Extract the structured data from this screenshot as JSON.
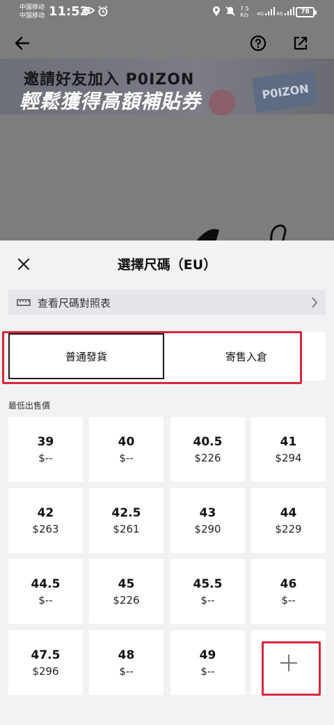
{
  "status_bar": {
    "carrier_1": "中国移动",
    "carrier_2": "中国移动",
    "time": "11:52",
    "net_speed_value": "7.5",
    "net_speed_unit": "K/s",
    "signal_1": "4G",
    "signal_2": "4G",
    "battery": "78"
  },
  "banner": {
    "line1": "邀請好友加入 P0IZON",
    "line2": "輕鬆獲得高額補貼券",
    "logo": "P0IZON"
  },
  "sheet": {
    "title": "選擇尺碼（EU）",
    "size_chart_label": "查看尺碼對照表",
    "shipping_tabs": [
      {
        "label": "普通發貨",
        "selected": true
      },
      {
        "label": "寄售入倉",
        "selected": false
      }
    ],
    "section_label": "最低出售價",
    "sizes": [
      {
        "size": "39",
        "price": "$--"
      },
      {
        "size": "40",
        "price": "$--"
      },
      {
        "size": "40.5",
        "price": "$226"
      },
      {
        "size": "41",
        "price": "$294"
      },
      {
        "size": "42",
        "price": "$263"
      },
      {
        "size": "42.5",
        "price": "$261"
      },
      {
        "size": "43",
        "price": "$290"
      },
      {
        "size": "44",
        "price": "$229"
      },
      {
        "size": "44.5",
        "price": "$--"
      },
      {
        "size": "45",
        "price": "$226"
      },
      {
        "size": "45.5",
        "price": "$--"
      },
      {
        "size": "46",
        "price": "$--"
      },
      {
        "size": "47.5",
        "price": "$296"
      },
      {
        "size": "48",
        "price": "$--"
      },
      {
        "size": "49",
        "price": "$--"
      }
    ]
  },
  "colors": {
    "highlight_red": "#d9263b",
    "selected_border": "#1a1a1a",
    "sheet_bg": "#f2f2f4"
  },
  "icons": [
    "back-arrow-icon",
    "help-icon",
    "share-icon",
    "close-icon",
    "ruler-icon",
    "chevron-right-icon",
    "plus-icon"
  ]
}
